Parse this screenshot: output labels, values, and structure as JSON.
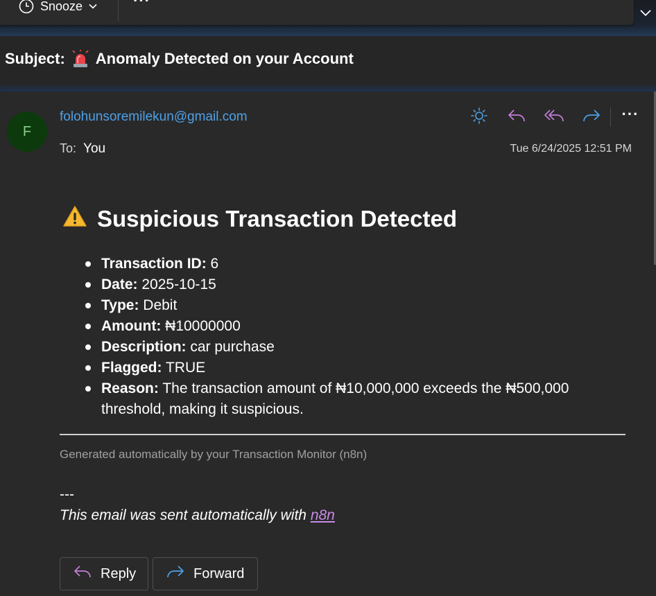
{
  "toolbar": {
    "snooze_label": "Snooze",
    "more_label": "···"
  },
  "subject": {
    "prefix": "Subject:",
    "text": "Anomaly Detected on your Account"
  },
  "message": {
    "sender_initial": "F",
    "sender_email": "folohunsoremilekun@gmail.com",
    "to_label": "To:",
    "to_value": "You",
    "date": "Tue 6/24/2025 12:51 PM",
    "more_label": "···"
  },
  "body": {
    "heading": "Suspicious Transaction Detected",
    "details": [
      {
        "label": "Transaction ID:",
        "value": " 6"
      },
      {
        "label": "Date:",
        "value": " 2025-10-15"
      },
      {
        "label": "Type:",
        "value": " Debit"
      },
      {
        "label": "Amount:",
        "value": " ₦10000000"
      },
      {
        "label": "Description:",
        "value": " car purchase"
      },
      {
        "label": "Flagged:",
        "value": " TRUE"
      },
      {
        "label": "Reason:",
        "value": " The transaction amount of ₦10,000,000 exceeds the ₦500,000 threshold, making it suspicious."
      }
    ],
    "generated_note": "Generated automatically by your Transaction Monitor (n8n)",
    "separator": "---",
    "footer_text": "This email was sent automatically with ",
    "footer_link": "n8n"
  },
  "buttons": {
    "reply_label": "Reply",
    "forward_label": "Forward"
  },
  "colors": {
    "link": "#4ea1e8",
    "reply_accent": "#c27fd8",
    "forward_accent": "#4ea1e8",
    "avatar_bg": "#0c3a0c"
  },
  "icons": [
    "clock-icon",
    "chevron-down-icon",
    "siren-icon",
    "sun-icon",
    "reply-icon",
    "reply-all-icon",
    "forward-icon",
    "warning-icon"
  ]
}
